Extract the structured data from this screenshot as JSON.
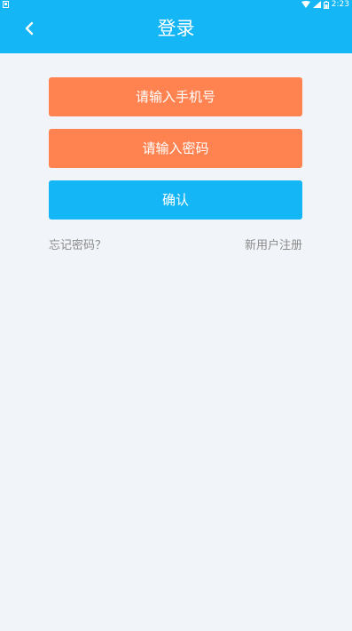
{
  "status_bar": {
    "time": "2:23",
    "icons": [
      "notification-icon",
      "wifi-icon",
      "signal-icon",
      "battery-icon"
    ],
    "color": "#14b6f5"
  },
  "header": {
    "title": "登录",
    "back_icon": "chevron-left-icon",
    "color": "#14b6f5"
  },
  "form": {
    "phone_placeholder": "请输入手机号",
    "password_placeholder": "请输入密码",
    "confirm_label": "确认",
    "input_color": "#ff8351",
    "button_color": "#14b6f5"
  },
  "links": {
    "forgot_password": "忘记密码？",
    "register": "新用户注册"
  },
  "background_color": "#f1f4f8"
}
